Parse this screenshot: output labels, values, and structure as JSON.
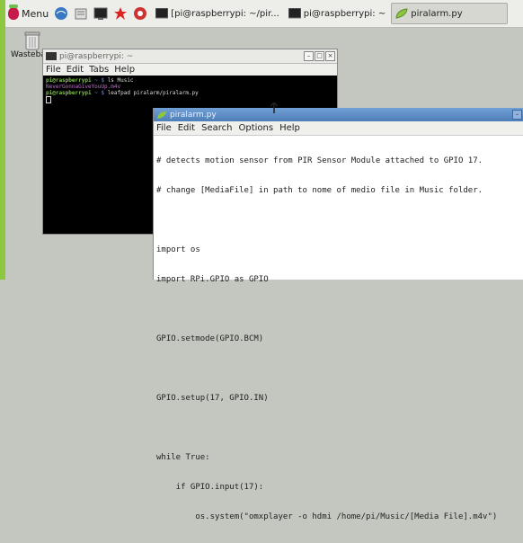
{
  "taskbar": {
    "menu_label": "Menu",
    "tasks": [
      {
        "label": "[pi@raspberrypi: ~/pir..."
      },
      {
        "label": "pi@raspberrypi: ~"
      },
      {
        "label": "piralarm.py"
      }
    ]
  },
  "desktop": {
    "trash_label": "Wastebas"
  },
  "terminal": {
    "title": "pi@raspberrypi: ~",
    "menu": [
      "File",
      "Edit",
      "Tabs",
      "Help"
    ],
    "lines": [
      {
        "user": "pi@raspberrypi",
        "path": " ~ $ ",
        "cmd": "ls Music"
      },
      {
        "output": "NeverGonnaGiveYouUp.m4v"
      },
      {
        "user": "pi@raspberrypi",
        "path": " ~ $ ",
        "cmd": "leafpad piralarm/piralarm.py"
      }
    ]
  },
  "editor": {
    "title": "piralarm.py",
    "menu": [
      "File",
      "Edit",
      "Search",
      "Options",
      "Help"
    ],
    "code": [
      "# detects motion sensor from PIR Sensor Module attached to GPIO 17.",
      "# change [MediaFile] in path to nome of medio file in Music folder.",
      "",
      "import os",
      "import RPi.GPIO as GPIO",
      "",
      "GPIO.setmode(GPIO.BCM)",
      "",
      "GPIO.setup(17, GPIO.IN)",
      "",
      "while True:",
      "    if GPIO.input(17):",
      "        os.system(\"omxplayer -o hdmi /home/pi/Music/[Media File].m4v\")"
    ]
  },
  "colors": {
    "accent_green": "#8dc63f",
    "titlebar_blue": "#4f7fb8",
    "term_user": "#7fc24a",
    "term_path": "#6b8fd6"
  }
}
